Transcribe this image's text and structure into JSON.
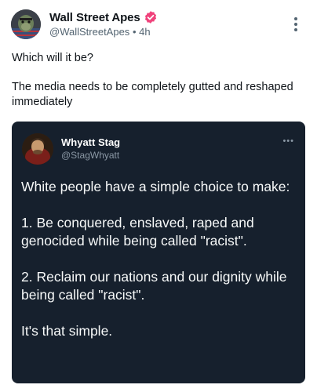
{
  "post": {
    "author": {
      "display_name": "Wall Street Apes",
      "handle": "@WallStreetApes",
      "separator": "•",
      "time_ago": "4h",
      "verified_color": "#f0427b"
    },
    "text": {
      "para1": "Which will it be?",
      "para2": "The media needs to be completely gutted and reshaped immediately"
    },
    "embedded": {
      "author": {
        "display_name": "Whyatt Stag",
        "handle": "@StagWhyatt"
      },
      "more_label": "•••",
      "paragraphs": [
        "White people have a simple choice to make:",
        "1. Be conquered, enslaved, raped and genocided while being called \"racist\".",
        "2. Reclaim our nations and our dignity while being called \"racist\".",
        "It's that simple."
      ],
      "background": "#16202d"
    }
  },
  "icons": {
    "more": "more-vertical-icon",
    "verified": "verified-badge-icon"
  }
}
